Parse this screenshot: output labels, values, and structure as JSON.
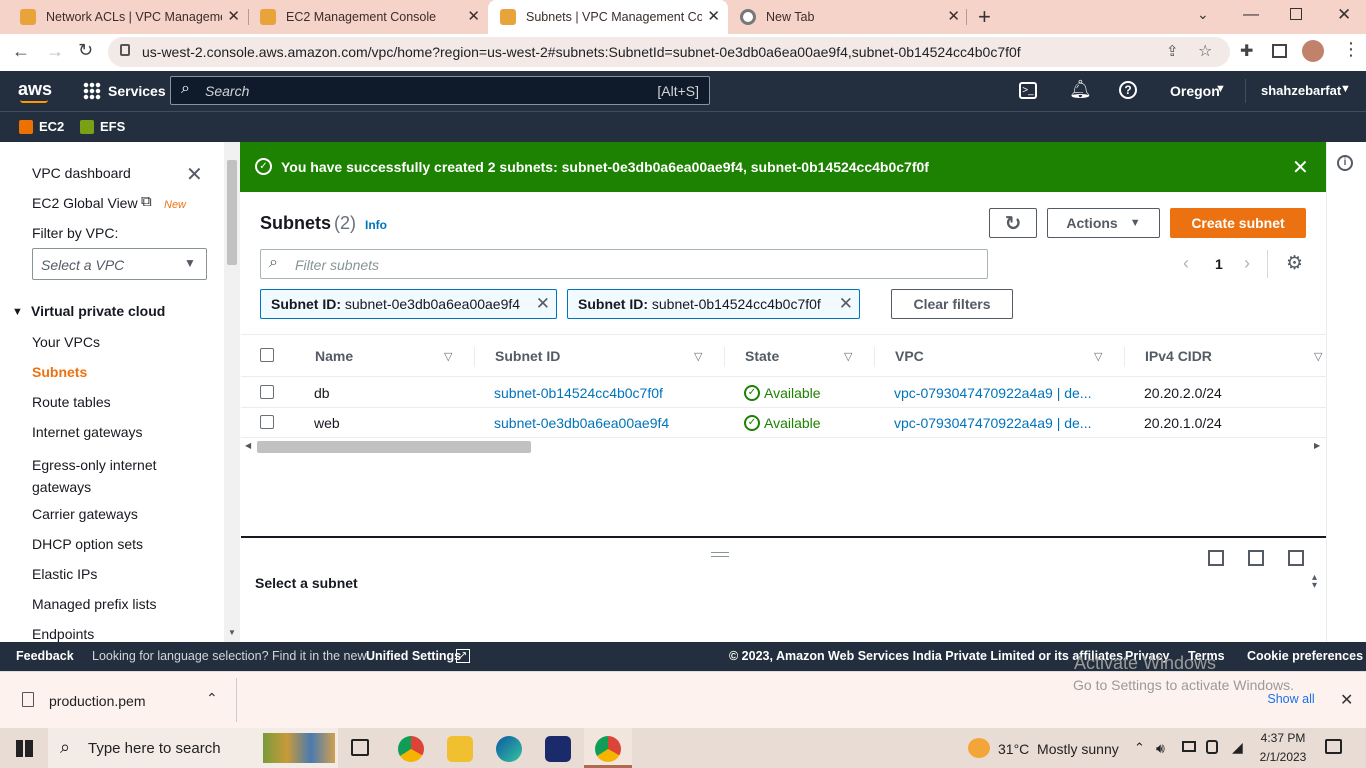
{
  "browser": {
    "tabs": [
      {
        "title": "Network ACLs | VPC Management Console",
        "icon_color": "#e8a33b"
      },
      {
        "title": "EC2 Management Console",
        "icon_color": "#e8a33b"
      },
      {
        "title": "Subnets | VPC Management Console",
        "icon_color": "#e8a33b"
      },
      {
        "title": "New Tab",
        "icon_color": "#777"
      }
    ],
    "url": "us-west-2.console.aws.amazon.com/vpc/home?region=us-west-2#subnets:SubnetId=subnet-0e3db0a6ea00ae9f4,subnet-0b14524cc4b0c7f0f"
  },
  "aws_header": {
    "logo": "aws",
    "services_label": "Services",
    "search_placeholder": "Search",
    "search_shortcut": "[Alt+S]",
    "region": "Oregon",
    "user": "shahzebarfat",
    "favorites": [
      {
        "label": "EC2",
        "color": "#ed7100"
      },
      {
        "label": "EFS",
        "color": "#7aa116"
      }
    ]
  },
  "sidebar": {
    "dashboard": "VPC dashboard",
    "global_view": "EC2 Global View",
    "new_badge": "New",
    "filter_label": "Filter by VPC:",
    "filter_placeholder": "Select a VPC",
    "section": "Virtual private cloud",
    "items": [
      "Your VPCs",
      "Subnets",
      "Route tables",
      "Internet gateways",
      "Egress-only internet gateways",
      "Carrier gateways",
      "DHCP option sets",
      "Elastic IPs",
      "Managed prefix lists",
      "Endpoints"
    ],
    "active_item": "Subnets"
  },
  "flash": {
    "message": "You have successfully created 2 subnets: subnet-0e3db0a6ea00ae9f4, subnet-0b14524cc4b0c7f0f"
  },
  "subnets": {
    "title": "Subnets",
    "count": "(2)",
    "info": "Info",
    "actions_label": "Actions",
    "create_label": "Create subnet",
    "filter_placeholder": "Filter subnets",
    "page": "1",
    "filters": [
      {
        "key": "Subnet ID:",
        "value": "subnet-0e3db0a6ea00ae9f4"
      },
      {
        "key": "Subnet ID:",
        "value": "subnet-0b14524cc4b0c7f0f"
      }
    ],
    "clear_label": "Clear filters",
    "columns": [
      "Name",
      "Subnet ID",
      "State",
      "VPC",
      "IPv4 CIDR"
    ],
    "rows": [
      {
        "name": "db",
        "subnet_id": "subnet-0b14524cc4b0c7f0f",
        "state": "Available",
        "vpc": "vpc-0793047470922a4a9 | de...",
        "cidr": "20.20.2.0/24"
      },
      {
        "name": "web",
        "subnet_id": "subnet-0e3db0a6ea00ae9f4",
        "state": "Available",
        "vpc": "vpc-0793047470922a4a9 | de...",
        "cidr": "20.20.1.0/24"
      }
    ],
    "detail_placeholder": "Select a subnet"
  },
  "footer": {
    "feedback": "Feedback",
    "language_text": "Looking for language selection? Find it in the new",
    "unified": "Unified Settings",
    "copyright": "© 2023, Amazon Web Services India Private Limited or its affiliates.",
    "privacy": "Privacy",
    "terms": "Terms",
    "cookies": "Cookie preferences"
  },
  "watermark": {
    "line1": "Activate Windows",
    "line2": "Go to Settings to activate Windows."
  },
  "download": {
    "file": "production.pem",
    "show_all": "Show all"
  },
  "taskbar": {
    "search_placeholder": "Type here to search",
    "weather": "31°C  Mostly sunny",
    "time": "4:37 PM",
    "date": "2/1/2023"
  }
}
